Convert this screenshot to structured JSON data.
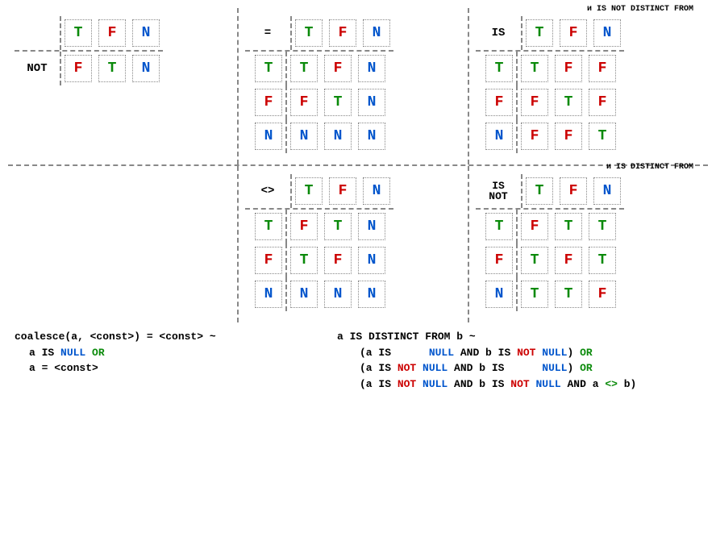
{
  "glyph": {
    "T": "T",
    "F": "F",
    "N": "N"
  },
  "ops": {
    "not": "NOT",
    "eq": "=",
    "is": "IS",
    "neq": "<>",
    "isnot_l1": "IS",
    "isnot_l2": "NOT"
  },
  "captions": {
    "is": "и IS NOT DISTINCT FROM",
    "isnot": "и IS DISTINCT FROM"
  },
  "tables": {
    "not": {
      "col_headers": [
        "T",
        "F",
        "N"
      ],
      "row_headers": [
        "NOT"
      ],
      "cells": [
        [
          "F",
          "T",
          "N"
        ]
      ]
    },
    "eq": {
      "col_headers": [
        "T",
        "F",
        "N"
      ],
      "row_headers": [
        "T",
        "F",
        "N"
      ],
      "cells": [
        [
          "T",
          "F",
          "N"
        ],
        [
          "F",
          "T",
          "N"
        ],
        [
          "N",
          "N",
          "N"
        ]
      ]
    },
    "is": {
      "col_headers": [
        "T",
        "F",
        "N"
      ],
      "row_headers": [
        "T",
        "F",
        "N"
      ],
      "cells": [
        [
          "T",
          "F",
          "F"
        ],
        [
          "F",
          "T",
          "F"
        ],
        [
          "F",
          "F",
          "T"
        ]
      ]
    },
    "neq": {
      "col_headers": [
        "T",
        "F",
        "N"
      ],
      "row_headers": [
        "T",
        "F",
        "N"
      ],
      "cells": [
        [
          "F",
          "T",
          "N"
        ],
        [
          "T",
          "F",
          "N"
        ],
        [
          "N",
          "N",
          "N"
        ]
      ]
    },
    "isnot": {
      "col_headers": [
        "T",
        "F",
        "N"
      ],
      "row_headers": [
        "T",
        "F",
        "N"
      ],
      "cells": [
        [
          "F",
          "T",
          "T"
        ],
        [
          "T",
          "F",
          "T"
        ],
        [
          "T",
          "T",
          "F"
        ]
      ]
    }
  },
  "bottom": {
    "coalesce_hdr": "coalesce(a, <const>) = <const> ~",
    "coalesce_l1_pre": "a IS ",
    "coalesce_l1_null": "NULL",
    "coalesce_l1_sp": " ",
    "coalesce_l1_or": "OR",
    "coalesce_l2": "a = <const>",
    "distinct_hdr": "a IS DISTINCT FROM b ~",
    "lp": "(a IS ",
    "null": "NULL",
    "and_b_is": " AND b IS ",
    "not": "NOT",
    "close_or": ") ",
    "or": "OR",
    "and_a_ne_b_pre": " AND a ",
    "ne": "<>",
    "and_a_ne_b_post": " b)",
    "sp5": "     ",
    "sp1": " "
  }
}
